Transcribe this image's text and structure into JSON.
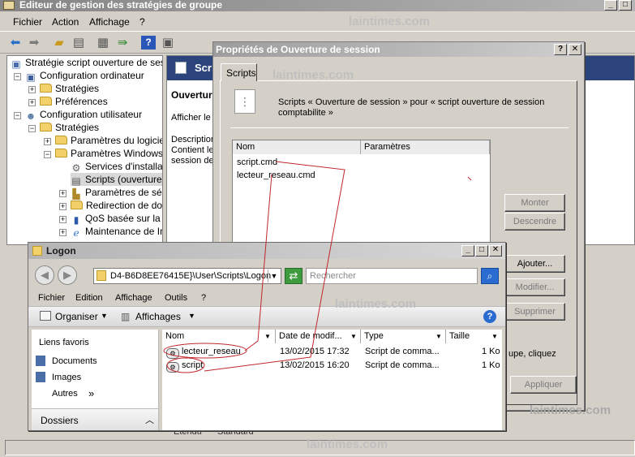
{
  "main_window": {
    "title": "Editeur de gestion des stratégies de groupe",
    "menu": [
      "Fichier",
      "Action",
      "Affichage",
      "?"
    ],
    "toolbar_icons": [
      "back-arrow-icon",
      "forward-arrow-icon",
      "up-folder-icon",
      "show-tree-icon",
      "properties-icon",
      "export-icon",
      "help-icon",
      "view-icon"
    ],
    "window_buttons": [
      "_",
      "□"
    ]
  },
  "tree": [
    {
      "label": "Stratégie script ouverture de sessi",
      "icon": "policy-icon",
      "expander": ""
    },
    {
      "label": "Configuration ordinateur",
      "icon": "computer-icon",
      "expander": "−"
    },
    {
      "label": "Stratégies",
      "icon": "folder-icon",
      "expander": "+"
    },
    {
      "label": "Préférences",
      "icon": "folder-icon",
      "expander": "+"
    },
    {
      "label": "Configuration utilisateur",
      "icon": "user-icon",
      "expander": "−"
    },
    {
      "label": "Stratégies",
      "icon": "folder-icon",
      "expander": "−"
    },
    {
      "label": "Paramètres du logiciel",
      "icon": "folder-icon",
      "expander": "+"
    },
    {
      "label": "Paramètres Windows",
      "icon": "folder-icon",
      "expander": "−"
    },
    {
      "label": "Services d'installati",
      "icon": "install-services-icon",
      "expander": ""
    },
    {
      "label": "Scripts (ouverture/",
      "icon": "scripts-icon",
      "expander": ""
    },
    {
      "label": "Paramètres de séc",
      "icon": "security-settings-icon",
      "expander": "+"
    },
    {
      "label": "Redirection de doss",
      "icon": "folder-icon",
      "expander": "+"
    },
    {
      "label": "QoS basée sur la s",
      "icon": "qos-chart-icon",
      "expander": "+"
    },
    {
      "label": "Maintenance de In",
      "icon": "ie-maintenance-icon",
      "expander": "+"
    }
  ],
  "right_pane": {
    "banner_title": "Scr",
    "heading": "Ouvertur",
    "show_link": "Afficher le",
    "description_lines": [
      "Description",
      "Contient le",
      "session de"
    ]
  },
  "props_dialog": {
    "title": "Propriétés de Ouverture de session",
    "title_buttons": [
      "?",
      "✕"
    ],
    "tab": "Scripts",
    "description": "Scripts « Ouverture de session » pour « script ouverture de session comptabilite »",
    "columns": [
      "Nom",
      "Paramètres"
    ],
    "scripts": [
      "script.cmd",
      "lecteur_reseau.cmd"
    ],
    "buttons": {
      "up": "Monter",
      "down": "Descendre",
      "add": "Ajouter...",
      "edit": "Modifier...",
      "remove": "Supprimer",
      "apply": "Appliquer"
    },
    "hint_text": "upe, cliquez"
  },
  "logon_window": {
    "title": "Logon",
    "title_buttons": [
      "_",
      "□",
      "✕"
    ],
    "address": "D4-B6D8EE76415E}\\User\\Scripts\\Logon",
    "search_placeholder": "Rechercher",
    "menu": [
      "Fichier",
      "Edition",
      "Affichage",
      "Outils",
      "?"
    ],
    "toolbar": {
      "organize": "Organiser",
      "views": "Affichages"
    },
    "favorites": {
      "heading": "Liens favoris",
      "items": [
        "Documents",
        "Images",
        "Autres"
      ],
      "more_glyph": "»",
      "folders_label": "Dossiers"
    },
    "columns": [
      "Nom",
      "Date de modif...",
      "Type",
      "Taille"
    ],
    "files": [
      {
        "name": "lecteur_reseau",
        "date": "13/02/2015 17:32",
        "type": "Script de comma...",
        "size": "1 Ko"
      },
      {
        "name": "script",
        "date": "13/02/2015 16:20",
        "type": "Script de comma...",
        "size": "1 Ko"
      }
    ]
  },
  "background_tabs": [
    "Etendu",
    "Standard"
  ],
  "watermark": "laintimes.com",
  "annotation_color": "#c0262c"
}
